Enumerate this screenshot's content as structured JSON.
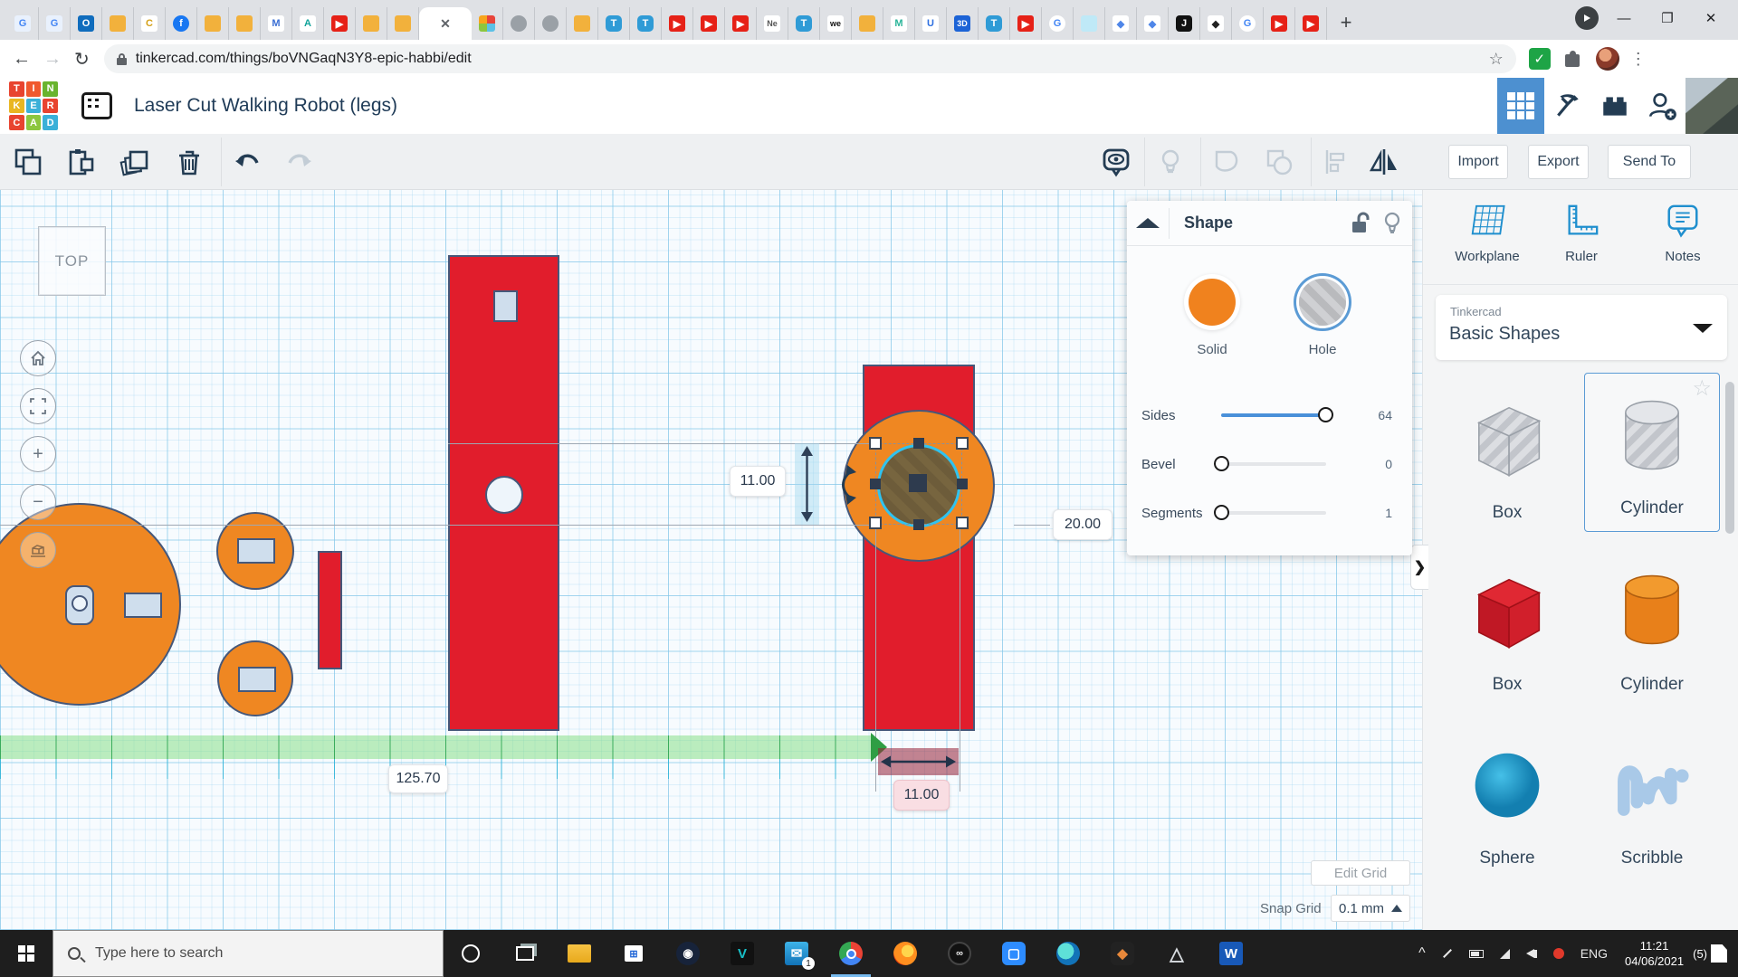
{
  "browser": {
    "tabs": [
      {
        "type": "translate"
      },
      {
        "type": "translate"
      },
      {
        "type": "outlook"
      },
      {
        "type": "robot"
      },
      {
        "type": "cgold"
      },
      {
        "type": "facebook"
      },
      {
        "type": "robot"
      },
      {
        "type": "robot"
      },
      {
        "type": "mhex"
      },
      {
        "type": "autodesk"
      },
      {
        "type": "youtube"
      },
      {
        "type": "robot"
      },
      {
        "type": "robot"
      },
      {
        "type": "active"
      },
      {
        "type": "tinkercolor"
      },
      {
        "type": "globe"
      },
      {
        "type": "globe"
      },
      {
        "type": "robot"
      },
      {
        "type": "tinkerblue"
      },
      {
        "type": "tinkerblue"
      },
      {
        "type": "youtube"
      },
      {
        "type": "youtube"
      },
      {
        "type": "youtube"
      },
      {
        "type": "ne"
      },
      {
        "type": "tinkerblue"
      },
      {
        "type": "we"
      },
      {
        "type": "robot"
      },
      {
        "type": "mgreen"
      },
      {
        "type": "ublue"
      },
      {
        "type": "threeD"
      },
      {
        "type": "tinkerblue"
      },
      {
        "type": "youtube"
      },
      {
        "type": "google"
      },
      {
        "type": "kiddom"
      },
      {
        "type": "book"
      },
      {
        "type": "book"
      },
      {
        "type": "jblack"
      },
      {
        "type": "inkscape"
      },
      {
        "type": "google"
      },
      {
        "type": "youtube"
      },
      {
        "type": "youtube"
      }
    ],
    "active_close": "✕",
    "newtab": "+",
    "window_controls": {
      "minimize": "—",
      "maximize": "❐",
      "close": "✕"
    },
    "back": "←",
    "forward": "→",
    "reload": "↻",
    "url": "tinkercad.com/things/boVNGaqN3Y8-epic-habbi/edit",
    "bookmark_star": "☆",
    "ext_check": "✓",
    "menu_kebab": "⋮"
  },
  "tc_header": {
    "logo_letters": [
      "T",
      "I",
      "N",
      "K",
      "E",
      "R",
      "C",
      "A",
      "D"
    ],
    "logo_colors": [
      "#e8442f",
      "#f0592e",
      "#69b42e",
      "#e9b621",
      "#3bb0d8",
      "#e8442f",
      "#e8442f",
      "#8cc63f",
      "#3bb0d8"
    ],
    "title": "Laser Cut Walking Robot (legs)"
  },
  "actionbar": {
    "import": "Import",
    "export": "Export",
    "send_to": "Send To"
  },
  "shape_panel": {
    "title": "Shape",
    "solid_label": "Solid",
    "hole_label": "Hole",
    "sliders": [
      {
        "label": "Sides",
        "value": "64"
      },
      {
        "label": "Bevel",
        "value": "0"
      },
      {
        "label": "Segments",
        "value": "1"
      }
    ]
  },
  "sidebar": {
    "workplane": "Workplane",
    "ruler": "Ruler",
    "notes": "Notes",
    "library_brand": "Tinkercad",
    "library_name": "Basic Shapes",
    "shapes": [
      {
        "label": "Box",
        "variant": "hole-box"
      },
      {
        "label": "Cylinder",
        "variant": "hole-cylinder",
        "selected": true
      },
      {
        "label": "Box",
        "variant": "red-box"
      },
      {
        "label": "Cylinder",
        "variant": "orange-cylinder"
      },
      {
        "label": "Sphere",
        "variant": "sphere"
      },
      {
        "label": "Scribble",
        "variant": "scribble"
      }
    ],
    "favorite_star": "☆",
    "chevron": "❯",
    "edit_grid": "Edit Grid",
    "snap_grid_label": "Snap Grid",
    "snap_grid_value": "0.1 mm"
  },
  "canvas": {
    "view_label": "TOP",
    "zoom_in": "+",
    "zoom_out": "−",
    "dim_height": "11.00",
    "dim_width": "11.00",
    "dim_elevation": "20.00",
    "ruler_value": "125.70"
  },
  "taskbar": {
    "search_placeholder": "Type here to search",
    "icons": [
      "cortana",
      "taskview",
      "folder",
      "store",
      "steam",
      "predator",
      "mail",
      "chrome",
      "firefox",
      "oval",
      "camera",
      "teal",
      "resolve",
      "tri",
      "word"
    ],
    "active_icon": "chrome",
    "mail_badge": "1",
    "tray_caret": "^",
    "language": "ENG",
    "time": "11:21",
    "date": "04/06/2021",
    "notif_count": "(5)"
  },
  "colors": {
    "accent_blue": "#4a90d9",
    "solid_orange": "#f0821e",
    "shape_red": "#e11d2c",
    "shape_orange": "#ef8722",
    "outline_navy": "#46587a",
    "hole_cyan_ring": "#2fc3f0"
  }
}
